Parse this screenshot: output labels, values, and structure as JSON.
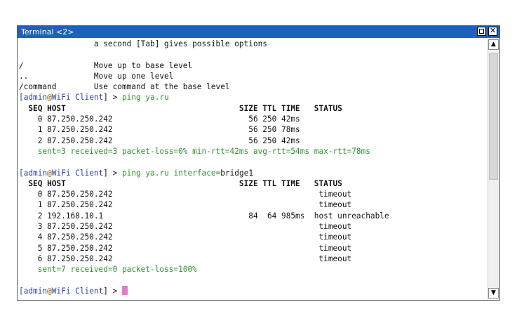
{
  "window": {
    "title": "Terminal <2>"
  },
  "terminal": {
    "lines": [
      {
        "type": "text",
        "text": "                a second [Tab] gives possible options"
      },
      {
        "type": "text",
        "text": ""
      },
      {
        "type": "text",
        "text": "/               Move up to base level"
      },
      {
        "type": "text",
        "text": "..              Move up one level"
      },
      {
        "type": "text",
        "text": "/command        Use command at the base level"
      },
      {
        "type": "prompt",
        "user": "admin",
        "at": "@",
        "host": "WiFi Client",
        "suffix": "] > ",
        "cmd": "ping ya.ru",
        "opt": "",
        "optval": ""
      },
      {
        "type": "header",
        "text": "  SEQ HOST                                     SIZE TTL TIME   STATUS"
      },
      {
        "type": "text",
        "text": "    0 87.250.250.242                             56 250 42ms"
      },
      {
        "type": "text",
        "text": "    1 87.250.250.242                             56 250 78ms"
      },
      {
        "type": "text",
        "text": "    2 87.250.250.242                             56 250 42ms"
      },
      {
        "type": "summary",
        "text": "    sent=3 received=3 packet-loss=0% min-rtt=42ms avg-rtt=54ms max-rtt=78ms"
      },
      {
        "type": "text",
        "text": ""
      },
      {
        "type": "prompt",
        "user": "admin",
        "at": "@",
        "host": "WiFi Client",
        "suffix": "] > ",
        "cmd": "ping ya.ru ",
        "opt": "interface=",
        "optval": "bridge1"
      },
      {
        "type": "header",
        "text": "  SEQ HOST                                     SIZE TTL TIME   STATUS"
      },
      {
        "type": "text",
        "text": "    0 87.250.250.242                                            timeout"
      },
      {
        "type": "text",
        "text": "    1 87.250.250.242                                            timeout"
      },
      {
        "type": "text",
        "text": "    2 192.168.10.1                               84  64 985ms  host unreachable"
      },
      {
        "type": "text",
        "text": "    3 87.250.250.242                                            timeout"
      },
      {
        "type": "text",
        "text": "    4 87.250.250.242                                            timeout"
      },
      {
        "type": "text",
        "text": "    5 87.250.250.242                                            timeout"
      },
      {
        "type": "text",
        "text": "    6 87.250.250.242                                            timeout"
      },
      {
        "type": "summary",
        "text": "    sent=7 received=0 packet-loss=100%"
      },
      {
        "type": "text",
        "text": ""
      },
      {
        "type": "prompt-cursor",
        "user": "admin",
        "at": "@",
        "host": "WiFi Client",
        "suffix": "] > "
      }
    ]
  },
  "scrollbar": {
    "up_icon": "arrow-up-icon",
    "down_icon": "arrow-down-icon"
  },
  "colors": {
    "titlebar": "#2060b8",
    "prompt": "#2c3fa8",
    "command": "#2f8f2f",
    "cursor": "#e27ec8"
  }
}
